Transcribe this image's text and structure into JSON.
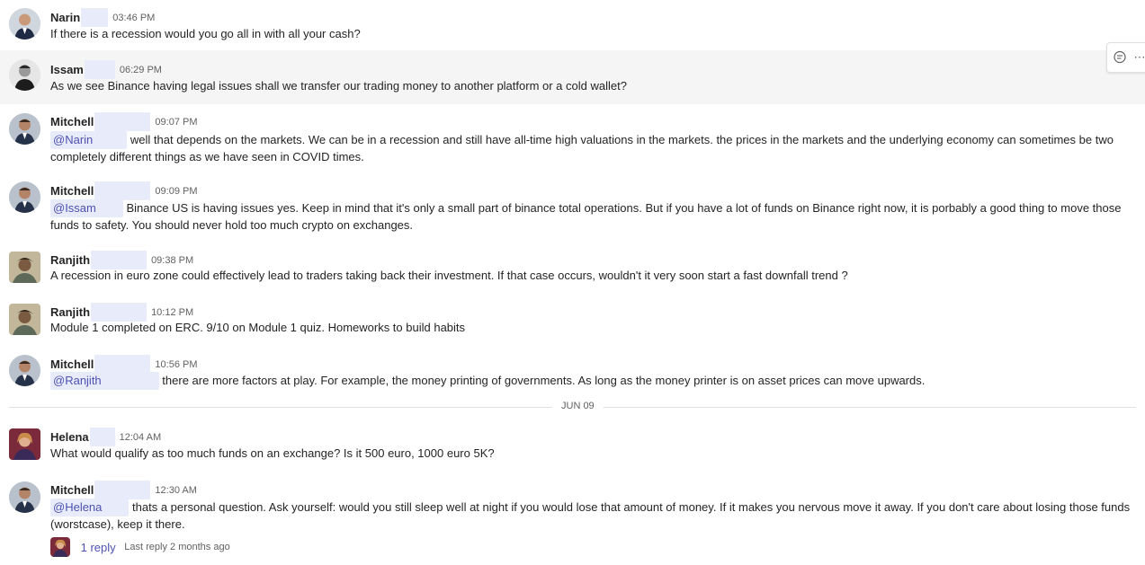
{
  "messages": [
    {
      "name": "Narin",
      "time": "03:46 PM",
      "text": "If there is a recession would you go all in with all your cash?"
    },
    {
      "name": "Issam",
      "time": "06:29 PM",
      "text": "As we see Binance having legal issues shall we transfer our trading money to another platform or a cold wallet?"
    },
    {
      "name": "Mitchell",
      "time": "09:07 PM",
      "mention": "@Narin",
      "text": "well that depends on the markets. We can be in a recession and still have all-time high valuations in the markets. the prices in the markets and the underlying economy can sometimes be two completely different things as we have seen in COVID times."
    },
    {
      "name": "Mitchell",
      "time": "09:09 PM",
      "mention": "@Issam",
      "text": "Binance US is having issues yes. Keep in mind that it's only a small part of binance total operations. But if you have a lot of funds on Binance right now, it is porbably a good thing to move those funds to safety. You should never hold too much crypto on exchanges."
    },
    {
      "name": "Ranjith",
      "time": "09:38 PM",
      "text": "A recession in euro zone could effectively lead to traders taking back their investment. If that case occurs, wouldn't it very soon start a fast downfall trend ?"
    },
    {
      "name": "Ranjith",
      "time": "10:12 PM",
      "text": "Module 1 completed on ERC. 9/10 on Module 1 quiz. Homeworks to build habits"
    },
    {
      "name": "Mitchell",
      "time": "10:56 PM",
      "mention": "@Ranjith",
      "text": "there are more factors at play. For example, the money printing of governments. As long as the money printer is on asset prices can move upwards."
    },
    {
      "name": "Helena",
      "time": "12:04 AM",
      "text": "What would qualify as too much funds on an exchange? Is it 500 euro, 1000 euro 5K?"
    },
    {
      "name": "Mitchell",
      "time": "12:30 AM",
      "mention": "@Helena",
      "text": "thats a personal question. Ask yourself: would you still sleep well at night if you would lose that amount of money. If it makes you nervous move it away. If you don't care about losing those funds (worstcase), keep it there."
    }
  ],
  "date_divider": "JUN 09",
  "thread": {
    "reply_count": "1 reply",
    "last_reply": "Last reply 2 months ago"
  },
  "toolbar": {
    "icons": [
      "reply-icon",
      "more-options-icon"
    ]
  },
  "colors": {
    "accent": "#4f52b2",
    "mention_bg": "#e8ebfa",
    "hover_bg": "#f5f5f5"
  }
}
